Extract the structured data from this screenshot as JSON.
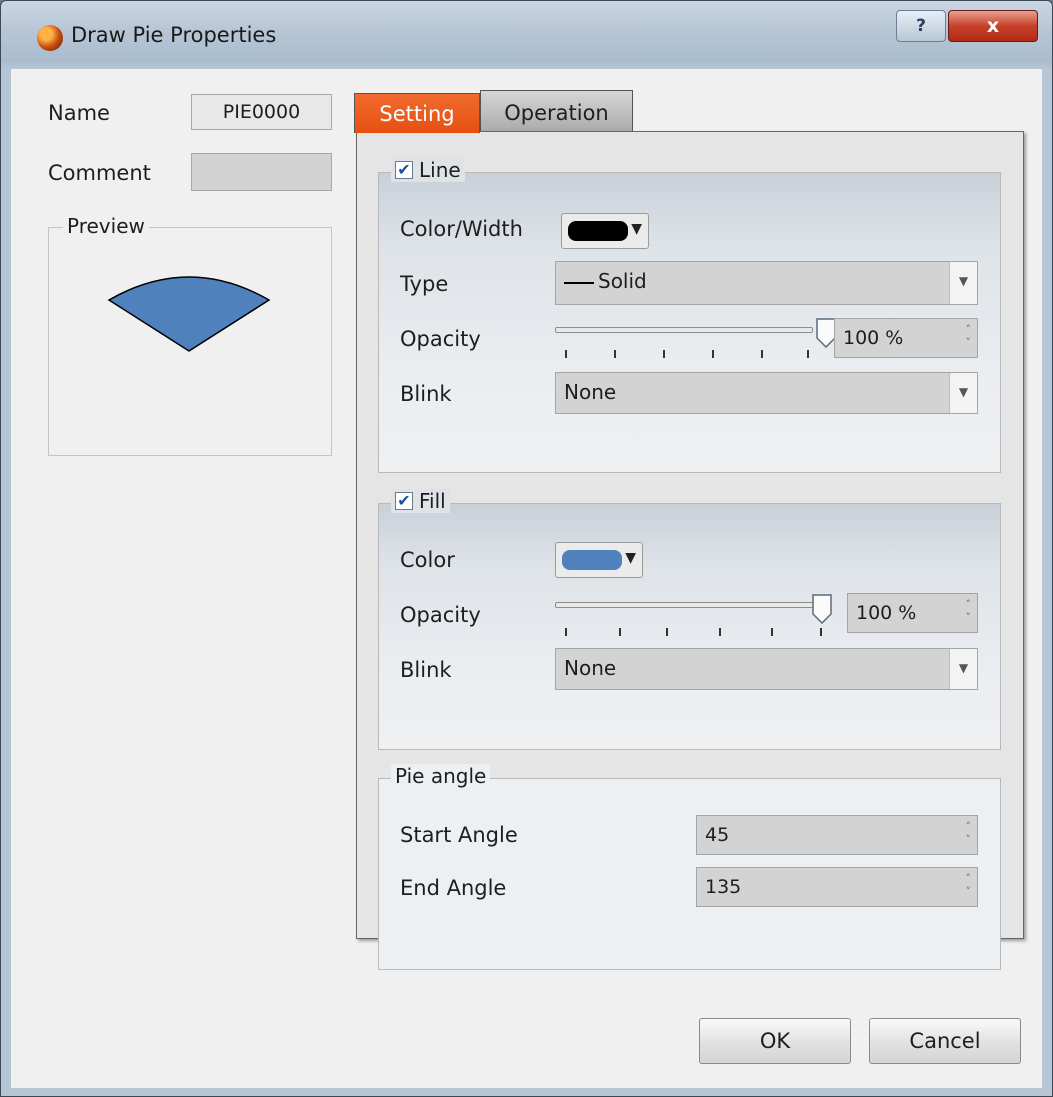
{
  "window": {
    "title": "Draw Pie Properties",
    "help_label": "?",
    "close_label": "x"
  },
  "left": {
    "name_label": "Name",
    "name_value": "PIE0000",
    "comment_label": "Comment",
    "comment_value": "",
    "preview_label": "Preview",
    "preview_fill": "#4f81bd"
  },
  "tabs": [
    {
      "label": "Setting"
    },
    {
      "label": "Operation"
    }
  ],
  "line": {
    "title": "Line",
    "checked": true,
    "color_width_label": "Color/Width",
    "color": "#000000",
    "type_label": "Type",
    "type_value": "Solid",
    "opacity_label": "Opacity",
    "opacity_value": "100 %",
    "opacity_level": 1.0,
    "blink_label": "Blink",
    "blink_value": "None"
  },
  "fill": {
    "title": "Fill",
    "checked": true,
    "color_label": "Color",
    "color": "#4f81bd",
    "opacity_label": "Opacity",
    "opacity_value": "100 %",
    "opacity_level": 1.0,
    "blink_label": "Blink",
    "blink_value": "None"
  },
  "pie_angle": {
    "title": "Pie angle",
    "start_label": "Start Angle",
    "start_value": "45",
    "end_label": "End Angle",
    "end_value": "135"
  },
  "buttons": {
    "ok": "OK",
    "cancel": "Cancel"
  },
  "colors": {
    "accent_tab": "#e65011"
  }
}
